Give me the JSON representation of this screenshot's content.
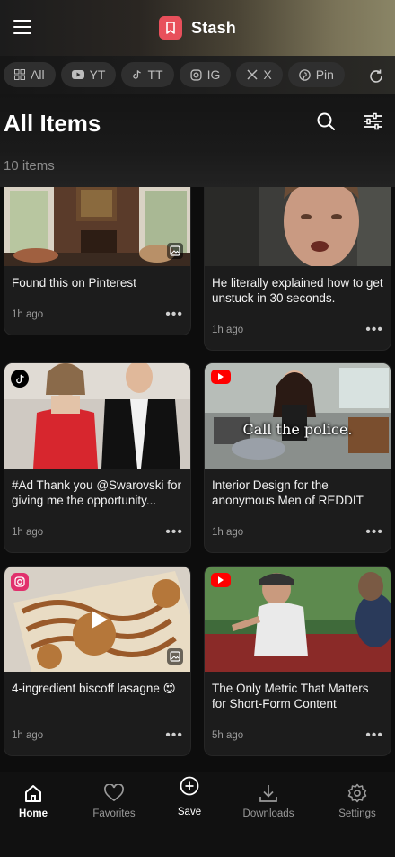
{
  "header": {
    "brand_name": "Stash"
  },
  "filters": [
    {
      "label": "All",
      "icon": "grid-icon"
    },
    {
      "label": "YT",
      "icon": "youtube-icon"
    },
    {
      "label": "TT",
      "icon": "tiktok-icon"
    },
    {
      "label": "IG",
      "icon": "instagram-icon"
    },
    {
      "label": "X",
      "icon": "x-icon"
    },
    {
      "label": "Pin",
      "icon": "pinterest-icon"
    }
  ],
  "page": {
    "title": "All Items",
    "count": "10 items"
  },
  "cards": [
    {
      "title": "Found this on Pinterest",
      "time": "1h ago",
      "source": "pinterest",
      "type": "image"
    },
    {
      "title": "He literally explained how to get unstuck in 30 seconds.",
      "time": "1h ago",
      "source": "video",
      "type": "video"
    },
    {
      "title": "#Ad Thank you @Swarovski for giving me the opportunity...",
      "time": "1h ago",
      "source": "tiktok",
      "type": "video"
    },
    {
      "title": "Interior Design for the anonymous Men of REDDIT",
      "time": "1h ago",
      "source": "youtube",
      "type": "video",
      "overlay_caption": "Call the police."
    },
    {
      "title": "4-ingredient biscoff lasagne 😍",
      "time": "1h ago",
      "source": "instagram",
      "type": "image"
    },
    {
      "title": "The Only Metric That Matters for Short-Form Content",
      "time": "5h ago",
      "source": "youtube",
      "type": "video"
    }
  ],
  "more_label": "•••",
  "nav": [
    {
      "label": "Home",
      "icon": "home-icon"
    },
    {
      "label": "Favorites",
      "icon": "heart-icon"
    },
    {
      "label": "Save",
      "icon": "plus-circle-icon"
    },
    {
      "label": "Downloads",
      "icon": "download-icon"
    },
    {
      "label": "Settings",
      "icon": "gear-icon"
    }
  ],
  "colors": {
    "accent": "#e8505b",
    "youtube": "#ff0000",
    "instagram": "#e1306c",
    "chip_bg": "#2f2f2f"
  }
}
